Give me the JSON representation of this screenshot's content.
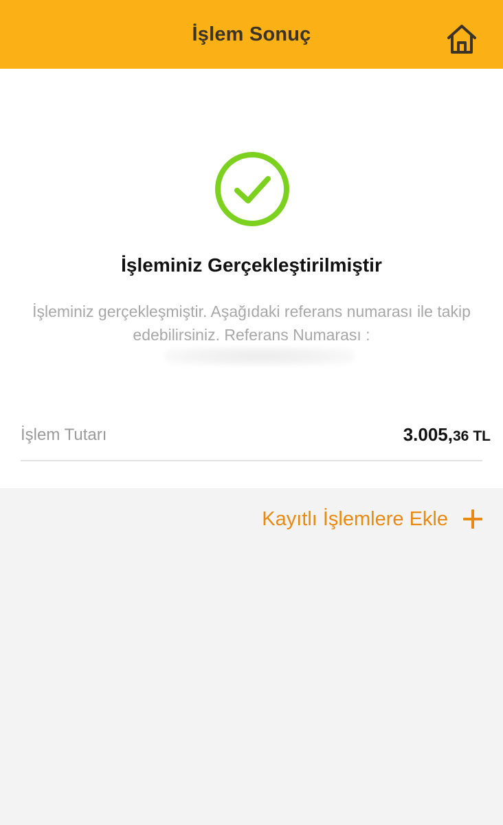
{
  "header": {
    "title": "İşlem Sonuç",
    "home_icon": "home-icon",
    "background_color": "#fbb116"
  },
  "result": {
    "status_icon": "check-circle-icon",
    "status_color": "#7cd11f",
    "title": "İşleminiz Gerçekleştirilmiştir",
    "description": "İşleminiz gerçekleşmiştir. Aşağıdaki referans numarası ile takip edebilirsiniz. Referans Numarası :"
  },
  "amount": {
    "label": "İşlem Tutarı",
    "integer": "3.005,",
    "decimal": "36",
    "currency": "TL"
  },
  "actions": {
    "add_saved_label": "Kayıtlı İşlemlere Ekle",
    "add_icon": "plus-icon",
    "accent_color": "#e88a12"
  }
}
